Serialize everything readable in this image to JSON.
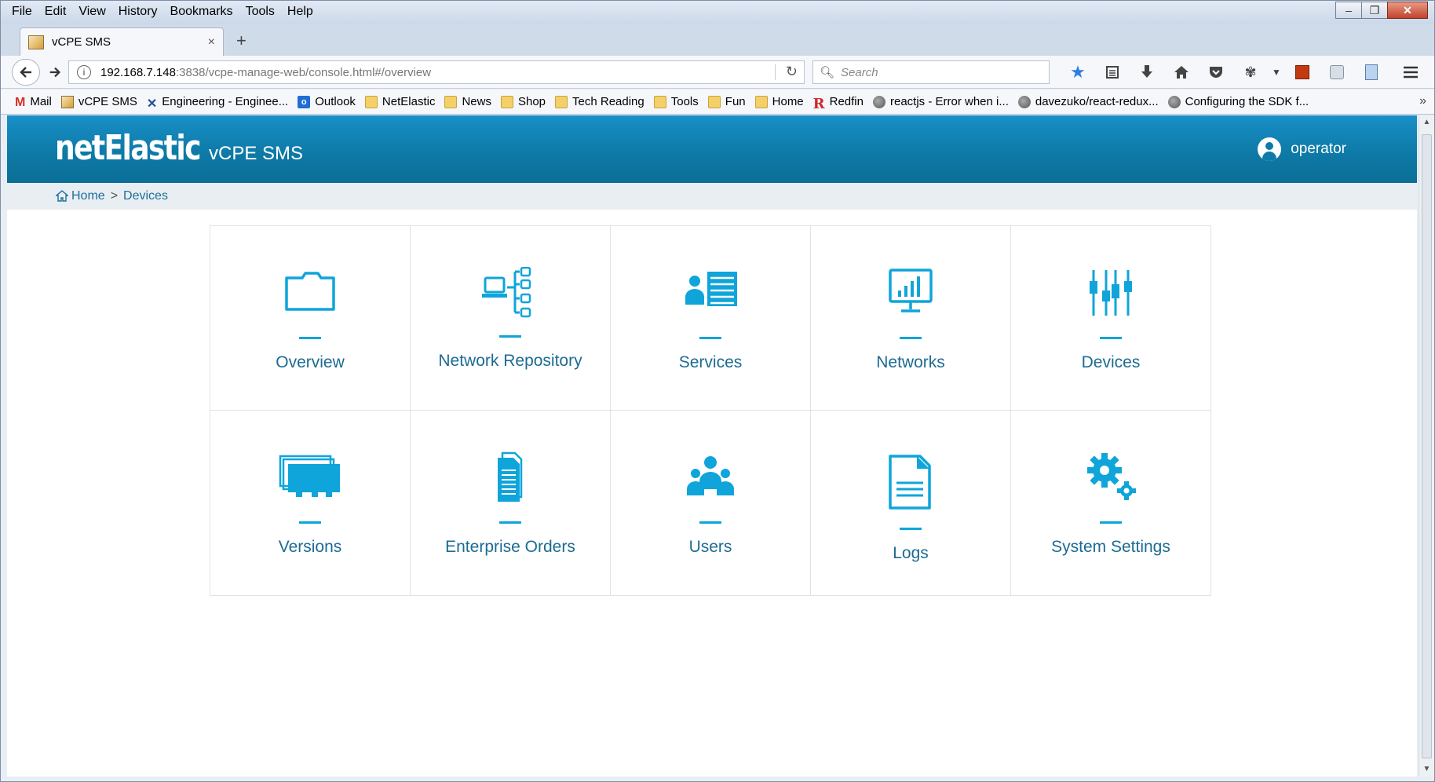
{
  "window": {
    "menu": [
      "File",
      "Edit",
      "View",
      "History",
      "Bookmarks",
      "Tools",
      "Help"
    ],
    "controls": {
      "minimize": "–",
      "maximize": "❐",
      "close": "✕"
    }
  },
  "tab": {
    "title": "vCPE SMS",
    "close": "×",
    "new_tab": "+"
  },
  "navbar": {
    "url_host": "192.168.7.148",
    "url_path": ":3838/vcpe-manage-web/console.html#/overview",
    "search_placeholder": "Search",
    "icons": [
      "bookmark-star-icon",
      "reading-list-icon",
      "download-icon",
      "home-icon",
      "pocket-icon",
      "extension-icon",
      "menu-dropdown-icon",
      "ublock-icon",
      "react-devtools-icon",
      "notes-icon",
      "hamburger-menu-icon"
    ]
  },
  "bookmarks": [
    {
      "label": "Mail",
      "icon": "gmail"
    },
    {
      "label": "vCPE SMS",
      "icon": "app"
    },
    {
      "label": "Engineering - Enginee...",
      "icon": "x"
    },
    {
      "label": "Outlook",
      "icon": "outlook"
    },
    {
      "label": "NetElastic",
      "icon": "folder"
    },
    {
      "label": "News",
      "icon": "folder"
    },
    {
      "label": "Shop",
      "icon": "folder"
    },
    {
      "label": "Tech Reading",
      "icon": "folder"
    },
    {
      "label": "Tools",
      "icon": "folder"
    },
    {
      "label": "Fun",
      "icon": "folder"
    },
    {
      "label": "Home",
      "icon": "folder"
    },
    {
      "label": "Redfin",
      "icon": "redfin"
    },
    {
      "label": "reactjs - Error when i...",
      "icon": "globe"
    },
    {
      "label": "davezuko/react-redux...",
      "icon": "globe"
    },
    {
      "label": "Configuring the SDK f...",
      "icon": "globe"
    }
  ],
  "app": {
    "brand": "netElastic",
    "product": "vCPE SMS",
    "user": "operator",
    "breadcrumb": {
      "home": "Home",
      "separator": ">",
      "current": "Devices"
    },
    "accent_color": "#0fa5da",
    "header_color": "#0e7aa7",
    "tiles": [
      {
        "label": "Overview",
        "icon": "folder-icon"
      },
      {
        "label": "Network Repository",
        "icon": "network-tree-icon"
      },
      {
        "label": "Services",
        "icon": "services-list-icon"
      },
      {
        "label": "Networks",
        "icon": "monitor-chart-icon"
      },
      {
        "label": "Devices",
        "icon": "sliders-icon"
      },
      {
        "label": "Versions",
        "icon": "versions-stack-icon"
      },
      {
        "label": "Enterprise Orders",
        "icon": "documents-icon"
      },
      {
        "label": "Users",
        "icon": "users-group-icon"
      },
      {
        "label": "Logs",
        "icon": "log-document-icon"
      },
      {
        "label": "System Settings",
        "icon": "gears-icon"
      }
    ]
  }
}
